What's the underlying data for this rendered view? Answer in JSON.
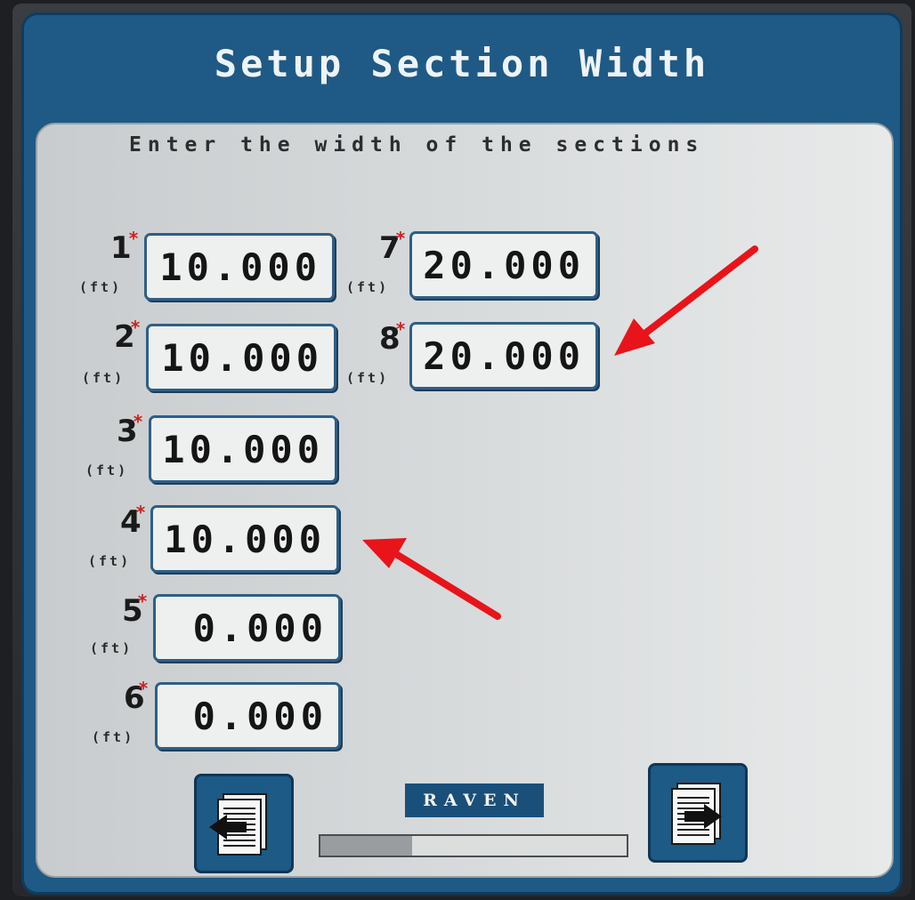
{
  "screen": {
    "title": "Setup Section Width",
    "subtitle": "Enter the width of the sections"
  },
  "sections": [
    {
      "number": "1",
      "unit": "(ft)",
      "value": "10.000"
    },
    {
      "number": "2",
      "unit": "(ft)",
      "value": "10.000"
    },
    {
      "number": "3",
      "unit": "(ft)",
      "value": "10.000"
    },
    {
      "number": "4",
      "unit": "(ft)",
      "value": "10.000"
    },
    {
      "number": "5",
      "unit": "(ft)",
      "value": "0.000"
    },
    {
      "number": "6",
      "unit": "(ft)",
      "value": "0.000"
    },
    {
      "number": "7",
      "unit": "(ft)",
      "value": "20.000"
    },
    {
      "number": "8",
      "unit": "(ft)",
      "value": "20.000"
    }
  ],
  "required_marker": "*",
  "footer": {
    "brand": "RAVEN",
    "progress_fraction": 0.3,
    "back_icon": "page-back-arrow-icon",
    "next_icon": "page-next-arrow-icon"
  },
  "colors": {
    "header_blue": "#1e5a85",
    "panel_gray": "#d9dcdd",
    "annotation_arrow": "#e8141a",
    "required_star": "#d02020"
  }
}
